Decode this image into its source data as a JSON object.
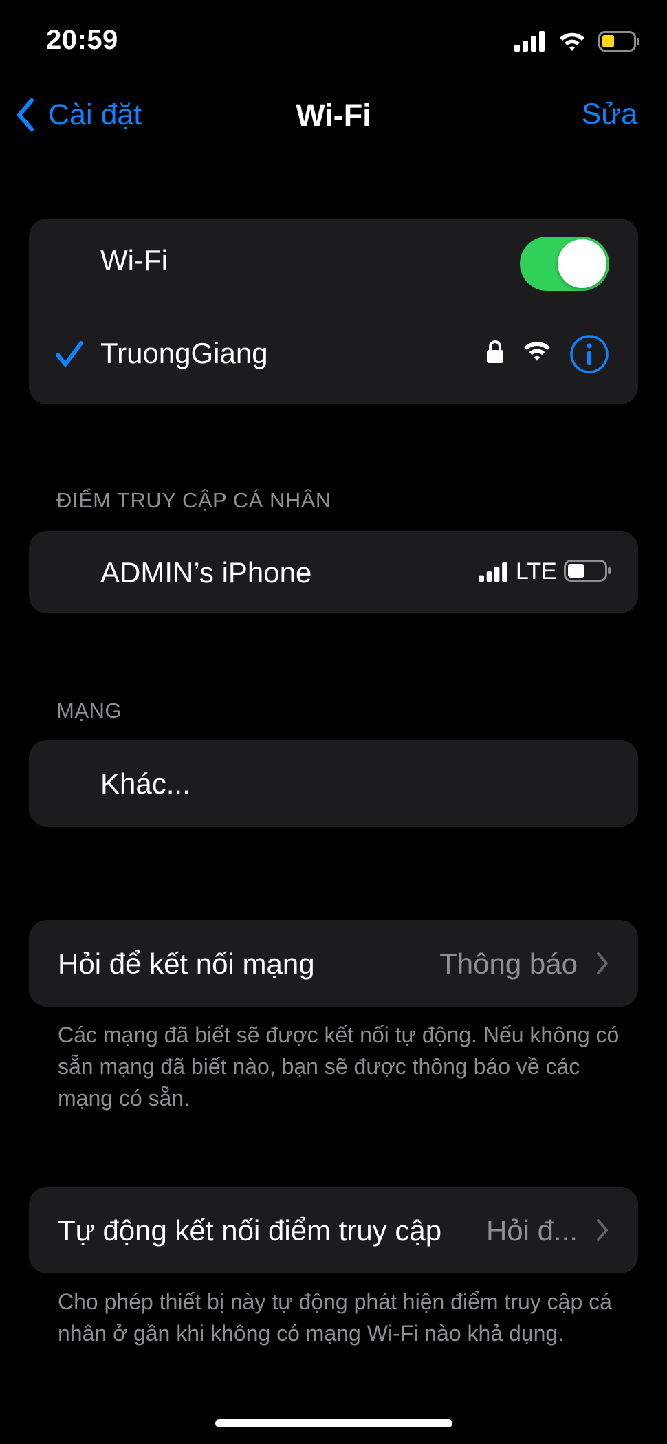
{
  "status_bar": {
    "time": "20:59"
  },
  "nav": {
    "back_label": "Cài đặt",
    "title": "Wi-Fi",
    "edit_label": "Sửa"
  },
  "wifi_card": {
    "toggle_label": "Wi-Fi",
    "toggle_on": true,
    "network_name": "TruongGiang"
  },
  "hotspot_section": {
    "header": "ĐIỂM TRUY CẬP CÁ NHÂN",
    "device_name": "ADMIN’s iPhone",
    "network_type": "LTE"
  },
  "networks_section": {
    "header": "MẠNG",
    "other_label": "Khác..."
  },
  "ask_to_join": {
    "label": "Hỏi để kết nối mạng",
    "value": "Thông báo",
    "footnote": "Các mạng đã biết sẽ được kết nối tự động. Nếu không có sẵn mạng đã biết nào, bạn sẽ được thông báo về các mạng có sẵn."
  },
  "auto_join_hotspot": {
    "label": "Tự động kết nối điểm truy cập",
    "value": "Hỏi đ...",
    "footnote": "Cho phép thiết bị này tự động phát hiện điểm truy cập cá nhân ở gần khi không có mạng Wi-Fi nào khả dụng."
  },
  "colors": {
    "accent": "#0a84ff",
    "toggle_on": "#30d158",
    "card_bg": "#1c1c1e",
    "secondary_text": "#8e8e93",
    "battery_low": "#ffd60a"
  }
}
